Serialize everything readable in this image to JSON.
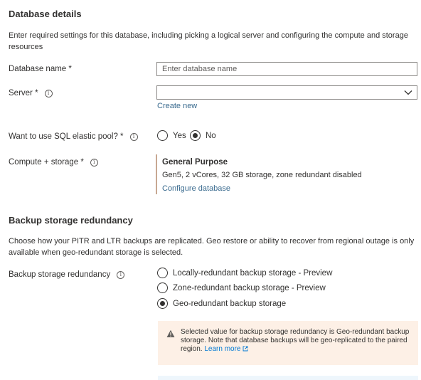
{
  "database_details": {
    "title": "Database details",
    "description": "Enter required settings for this database, including picking a logical server and configuring the compute and storage resources",
    "db_name_label": "Database name *",
    "db_name_placeholder": "Enter database name",
    "db_name_value": "",
    "server_label": "Server *",
    "server_value": "",
    "create_new": "Create new",
    "elastic_label": "Want to use SQL elastic pool? *",
    "elastic_options": [
      "Yes",
      "No"
    ],
    "elastic_selected": "No",
    "compute_label": "Compute + storage *",
    "compute_tier": "General Purpose",
    "compute_detail": "Gen5, 2 vCores, 32 GB storage, zone redundant disabled",
    "configure_link": "Configure database"
  },
  "backup": {
    "title": "Backup storage redundancy",
    "description": "Choose how your PITR and LTR backups are replicated. Geo restore or ability to recover from regional outage is only available when geo-redundant storage is selected.",
    "label": "Backup storage redundancy",
    "options": [
      "Locally-redundant backup storage - Preview",
      "Zone-redundant backup storage - Preview",
      "Geo-redundant backup storage"
    ],
    "selected": "Geo-redundant backup storage",
    "warning_text": "Selected value for backup storage redundancy is Geo-redundant backup storage. Note that database backups will be geo-replicated to the paired region.",
    "learn_more": "Learn more"
  },
  "icons": {
    "info": "info-icon",
    "chevron": "chevron-down-icon",
    "warning": "warning-icon",
    "external": "external-link-icon"
  }
}
